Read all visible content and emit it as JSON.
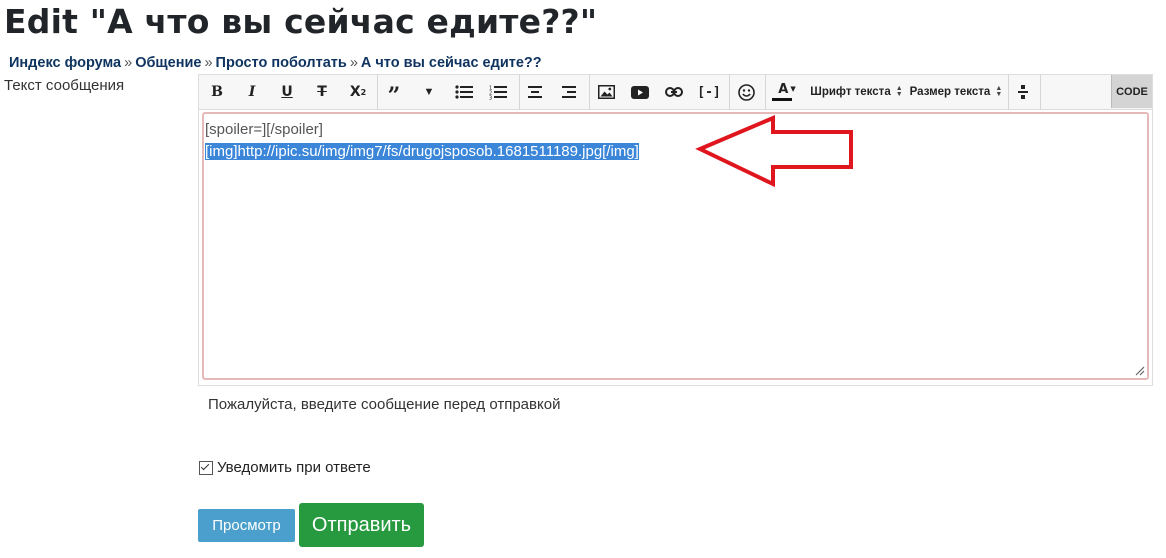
{
  "page": {
    "title": "Edit \"А что вы сейчас едите??\""
  },
  "breadcrumb": {
    "items": [
      "Индекс форума",
      "Общение",
      "Просто поболтать",
      "А что вы сейчас едите??"
    ],
    "separator": "»"
  },
  "form": {
    "message_label": "Текст сообщения",
    "error_message": "Пожалуйста, введите сообщение перед отправкой",
    "notify_label": "Уведомить при ответе",
    "notify_checked": true
  },
  "editor": {
    "font_select": "Шрифт текста",
    "size_select": "Размер текста",
    "code_label": "CODE",
    "content": {
      "line1": "[spoiler=][/spoiler]",
      "line2_selected": "[img]http://ipic.su/img/img7/fs/drugojsposob.1681511189.jpg[/img]"
    },
    "toolbar_icons": [
      "bold-icon",
      "italic-icon",
      "underline-icon",
      "strikethrough-icon",
      "superscript-icon",
      "quote-icon",
      "dropdown-icon",
      "bullet-list-icon",
      "numbered-list-icon",
      "align-center-icon",
      "align-right-icon",
      "image-icon",
      "youtube-icon",
      "link-icon",
      "spoiler-icon",
      "emoji-icon",
      "font-color-icon",
      "font-select",
      "font-size-select",
      "horizontal-rule-icon",
      "code-view-button"
    ]
  },
  "buttons": {
    "preview": "Просмотр",
    "submit": "Отправить"
  },
  "colors": {
    "title": "#212529",
    "breadcrumb_link": "#0f3460",
    "preview_bg": "#4a9fcc",
    "submit_bg": "#279a3f",
    "selection_bg": "#3b86d8",
    "annotation_arrow": "#e0161e"
  }
}
